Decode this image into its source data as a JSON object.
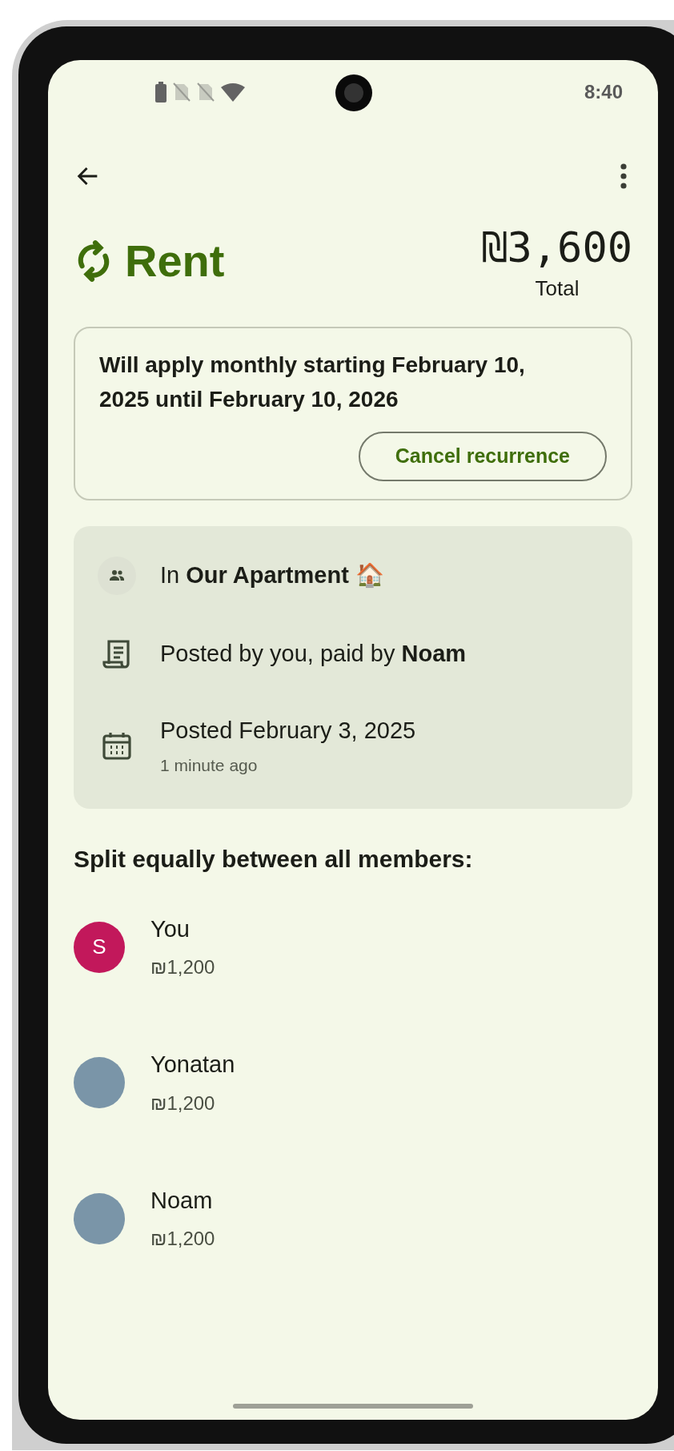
{
  "status_bar": {
    "time": "8:40"
  },
  "expense": {
    "title": "Rent",
    "recurring": true,
    "amount": "₪3,600",
    "amount_label": "Total"
  },
  "recurrence": {
    "text": "Will apply monthly starting February 10, 2025 until February 10, 2026",
    "button": "Cancel recurrence"
  },
  "details": [
    {
      "kind": "group",
      "text": "In **Our Apartment** 🏠"
    },
    {
      "kind": "receipt",
      "text": "Posted by you, paid by **Noam**"
    },
    {
      "kind": "date",
      "text": "Posted February 3, 2025",
      "subtext": "1 minute ago"
    }
  ],
  "split": {
    "heading": "Split equally between all members:",
    "members": [
      {
        "kind": "initial",
        "initial": "S",
        "color": "#c2185b",
        "name": "You",
        "amount": "₪1,200"
      },
      {
        "kind": "photo",
        "name": "Yonatan",
        "amount": "₪1,200"
      },
      {
        "kind": "photo",
        "name": "Noam",
        "amount": "₪1,200"
      }
    ]
  }
}
